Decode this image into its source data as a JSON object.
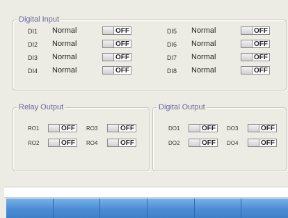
{
  "digital_input": {
    "title": "Digital Input",
    "items": [
      {
        "label": "DI1",
        "status": "Normal",
        "toggle": "OFF"
      },
      {
        "label": "DI2",
        "status": "Normal",
        "toggle": "OFF"
      },
      {
        "label": "DI3",
        "status": "Normal",
        "toggle": "OFF"
      },
      {
        "label": "DI4",
        "status": "Normal",
        "toggle": "OFF"
      },
      {
        "label": "DI5",
        "status": "Normal",
        "toggle": "OFF"
      },
      {
        "label": "DI6",
        "status": "Normal",
        "toggle": "OFF"
      },
      {
        "label": "DI7",
        "status": "Normal",
        "toggle": "OFF"
      },
      {
        "label": "DI8",
        "status": "Normal",
        "toggle": "OFF"
      }
    ]
  },
  "relay_output": {
    "title": "Relay Output",
    "items": [
      {
        "label": "RO1",
        "toggle": "OFF"
      },
      {
        "label": "RO3",
        "toggle": "OFF"
      },
      {
        "label": "RO2",
        "toggle": "OFF"
      },
      {
        "label": "RO4",
        "toggle": "OFF"
      }
    ]
  },
  "digital_output": {
    "title": "Digital Output",
    "items": [
      {
        "label": "DO1",
        "toggle": "OFF"
      },
      {
        "label": "DO3",
        "toggle": "OFF"
      },
      {
        "label": "DO2",
        "toggle": "OFF"
      },
      {
        "label": "DO4",
        "toggle": "OFF"
      }
    ]
  },
  "colors": {
    "background": "#ecebe4",
    "legend_text": "#6a6a9a",
    "softkey_blue": "#4d8fd6"
  }
}
